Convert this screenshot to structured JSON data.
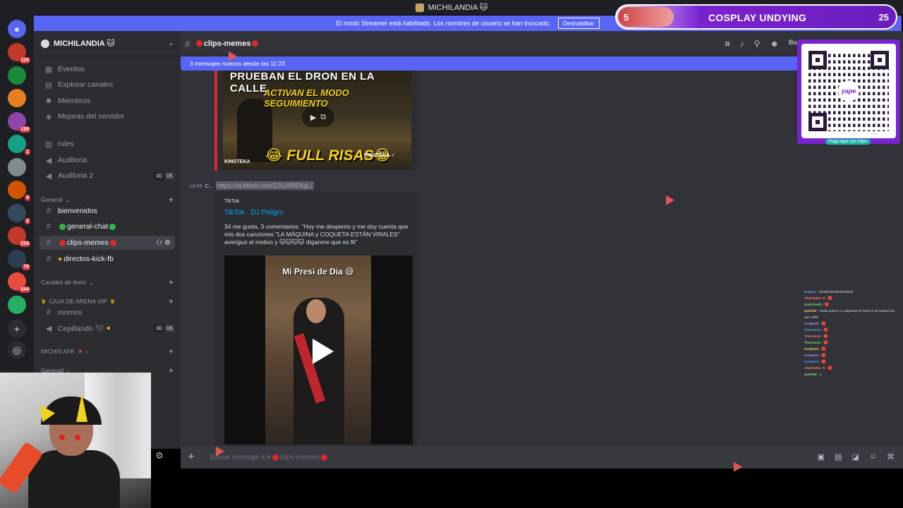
{
  "window": {
    "title": "MICHILANDIA 🐱"
  },
  "streamer_banner": {
    "text": "El modo Streamer está habilitado. Los nombres de usuario se han truncado.",
    "disable_button": "Deshabilitar"
  },
  "rail": {
    "badges": [
      "116",
      "198",
      "1",
      "5",
      "2",
      "234",
      "79",
      "544"
    ],
    "colors": [
      "#c0392b",
      "#1a8a3a",
      "#e67e22",
      "#8e44ad",
      "#16a085",
      "#7f8c8d",
      "#d35400",
      "#34495e",
      "#c0392b",
      "#2c3e50",
      "#e74c3c",
      "#27ae60",
      "#b03a2e",
      "#e5b53a"
    ],
    "add_icon": "plus-icon",
    "discover_icon": "compass-icon"
  },
  "guild": {
    "name": "MICHILANDIA 🐱",
    "menu": [
      "Eventos",
      "Explorar canales",
      "Miembros",
      "Mejoras del servidor"
    ],
    "top_channels": [
      {
        "name": "rules",
        "icon": "book-icon"
      },
      {
        "name": "Auditoria",
        "icon": "speaker-icon"
      },
      {
        "name": "Auditoria 2",
        "icon": "speaker-icon",
        "count_a": "00",
        "count_b": "05"
      }
    ],
    "category_general": "General",
    "general_channels": [
      "bienvenidos",
      "general-chat",
      "clips-memes",
      "directos-kick-fb"
    ],
    "category_text": "Canales de texto",
    "category_vip": "CAJA DE ARENA VIP",
    "vip_channels": [
      {
        "name": "momos"
      },
      {
        "name": "Cepillando 🖤",
        "count_a": "00",
        "count_b": "06"
      }
    ],
    "category_afk": "MICHIS AFK",
    "category_general2": "Generall"
  },
  "channel": {
    "name": "clips-memes",
    "new_messages": "3 mensajes nuevos desde las 11:23",
    "search_hint": "Bu"
  },
  "messages": {
    "embed1": {
      "title_top": "PRUEBAN EL DRON EN LA CALLE",
      "title_mid": "ACTIVAN EL MODO SEGUIMIENTO",
      "title_bottom": "😂 FULL RISAS😂",
      "watermark": "KINGTEKA",
      "watermark2": "KINGTEKA ✓"
    },
    "time": "14:09",
    "author": "C...",
    "link": "https://vt.tiktok.com/ZSUAREKgL/",
    "embed2": {
      "provider": "TikTok",
      "author": "TikTok · DJ Peligro",
      "description": "34 me gusta, 3 comentarios. \"Hoy me despierto y me doy cuenta que mis dos canciones \"LA MÁQUINA y COQUETA ESTÁN VIRALES\" averiguo el motivo y 🐱🐱🐱🐱 díganme que es fk\"",
      "caption": "Mi Presi de Dia 😅"
    }
  },
  "composer": {
    "placeholder_prefix": "Enviar mensaje a #",
    "placeholder_channel": "clips-memes"
  },
  "overlay": {
    "goal_current": "5",
    "goal_title": "COSPLAY UNDYING",
    "goal_max": "25",
    "goal_progress": 0.2,
    "qr_logo": "yape",
    "qr_caption": "Paga aquí con Yape",
    "chat": [
      {
        "user": "lhaipex :",
        "msg": "XDDDDDDDDDDDDD"
      },
      {
        "user": "Jharitzeka_R :",
        "msg": "🟥"
      },
      {
        "user": "SooFrienfs :",
        "msg": "🟥"
      },
      {
        "user": "quiz202 :",
        "msg": "Nada quiere o q digamos el michi el es verdad asi que chilin"
      },
      {
        "user": "KxSpeck :",
        "msg": "🟥"
      },
      {
        "user": "ThexoXxX :",
        "msg": "🟥"
      },
      {
        "user": "ThexoXxX :",
        "msg": "🟥"
      },
      {
        "user": "ThexoXxX :",
        "msg": "🟥"
      },
      {
        "user": "KxSpeck :",
        "msg": "🟥"
      },
      {
        "user": "KxSpeck :",
        "msg": "🟥"
      },
      {
        "user": "KxSpeck :",
        "msg": "🟥"
      },
      {
        "user": "Jharitzeka_R :",
        "msg": "🟥"
      },
      {
        "user": "quiz202 :",
        "msg": ":j"
      }
    ]
  },
  "icons": {
    "header": [
      "threads-icon",
      "bell-icon",
      "pin-icon",
      "members-icon"
    ],
    "composer": [
      "gift-icon",
      "gif-icon",
      "sticker-icon",
      "emoji-icon",
      "apps-icon"
    ]
  }
}
